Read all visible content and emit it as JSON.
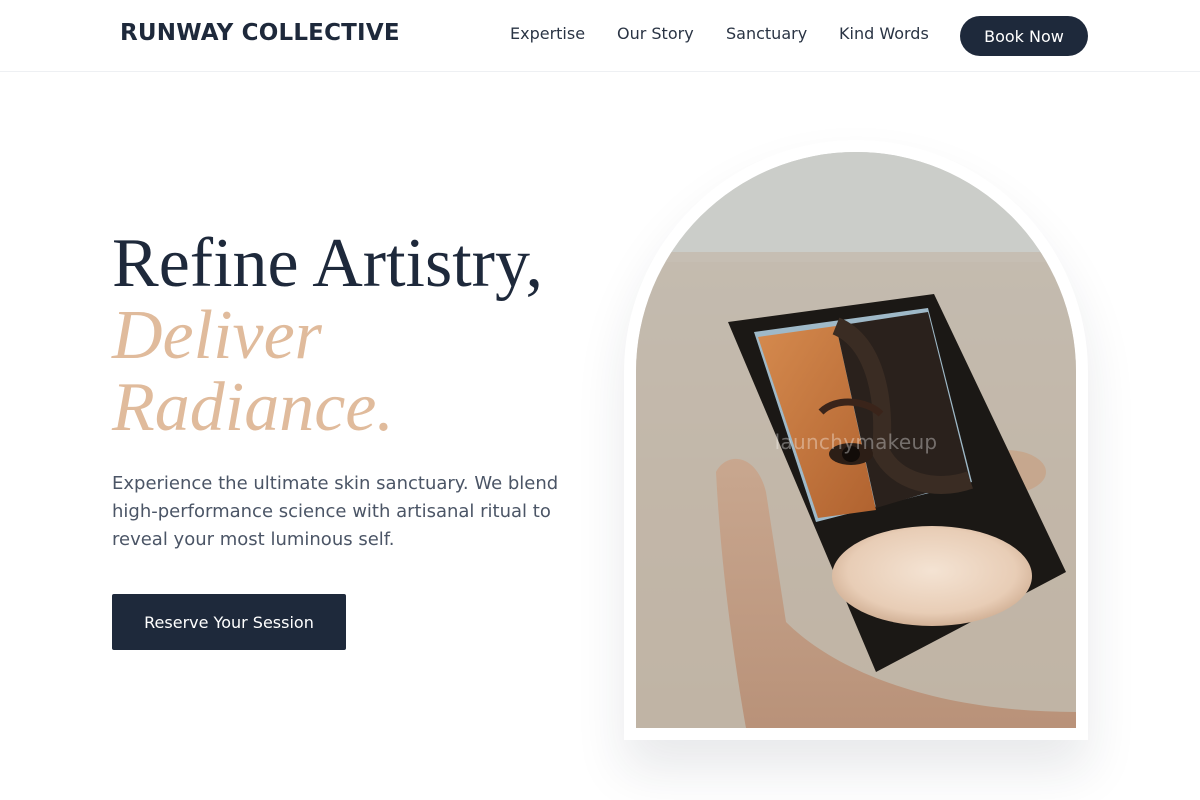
{
  "header": {
    "brand": "RUNWAY COLLECTIVE",
    "nav": [
      {
        "label": "Expertise"
      },
      {
        "label": "Our Story"
      },
      {
        "label": "Sanctuary"
      },
      {
        "label": "Kind Words"
      }
    ],
    "book_label": "Book Now"
  },
  "hero": {
    "headline_line1": "Refine Artistry,",
    "headline_line2": "Deliver",
    "headline_line3": "Radiance.",
    "subtext": "Experience the ultimate skin sanctuary. We blend high-performance science with artisanal ritual to reveal your most luminous self.",
    "cta_label": "Reserve Your Session",
    "image_watermark": "launchymakeup"
  },
  "colors": {
    "primary": "#1e293b",
    "accent": "#e0bb9c",
    "body_text": "#4b5566"
  }
}
